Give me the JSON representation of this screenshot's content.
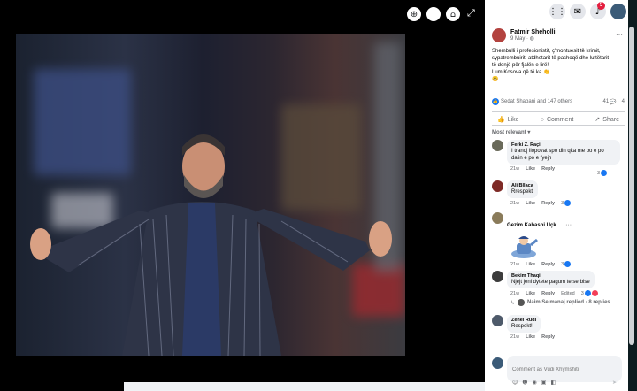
{
  "viewer": {
    "zoom_icon": "zoom-in-icon",
    "tag_icon": "tag-icon",
    "expand_icon": "expand-icon"
  },
  "topbar": {
    "notification_count": "5",
    "icons": [
      "menu-grid-icon",
      "messenger-icon",
      "bell-icon",
      "account-icon"
    ]
  },
  "post": {
    "author": "Fatmir Sheholli",
    "date": "9 May · ",
    "text_lines": [
      "Shembulli i profesionistit, ç'montuesit të krimit,",
      "sypatrembuirit, atdhetarit të pashoqë dhe luftëtarit",
      "të denjë për fjalën e lirë!",
      "Lum Kosova që të ka 👏",
      "😀"
    ],
    "reactions_text": "Sedat Shabani and 147 others",
    "comment_count": "41",
    "share_count": "4"
  },
  "actions": {
    "like": "Like",
    "comment": "Comment",
    "share": "Share"
  },
  "sort_label": "Most relevant ▾",
  "comments": [
    {
      "author": "Ferki Z. Raçi",
      "text": "I tranoj llopovat spo din qka me bo e po dalin e po e fyejn",
      "age": "21w",
      "like": "Like",
      "reply": "Reply",
      "reacts": "3"
    },
    {
      "author": "Ali Bllaca",
      "text": "Rrespekt",
      "age": "21w",
      "like": "Like",
      "reply": "Reply",
      "reacts": "3"
    },
    {
      "author": "Gezim Kabashi Uçk",
      "text": "",
      "age": "21w",
      "like": "Like",
      "reply": "Reply",
      "reacts": "3"
    },
    {
      "author": "Bekim Thaqi",
      "text": "Njejt jeni dytete pagum te serbise",
      "age": "21w",
      "like": "Like",
      "reply": "Reply",
      "edited": "Edited",
      "reacts": "3"
    },
    {
      "author": "Zenel Rudi",
      "text": "Respekt!",
      "age": "21w",
      "like": "Like",
      "reply": "Reply"
    }
  ],
  "reply_summary": "Naim Selmanaj replied · 8 replies",
  "comment_input": {
    "placeholder": "Comment as Vudi Xhymshiti"
  },
  "colors": {
    "facebook_blue": "#1877f2",
    "like_blue": "#1877f2",
    "badge_red": "#e41e3f",
    "bubble_grey": "#f0f2f5"
  }
}
